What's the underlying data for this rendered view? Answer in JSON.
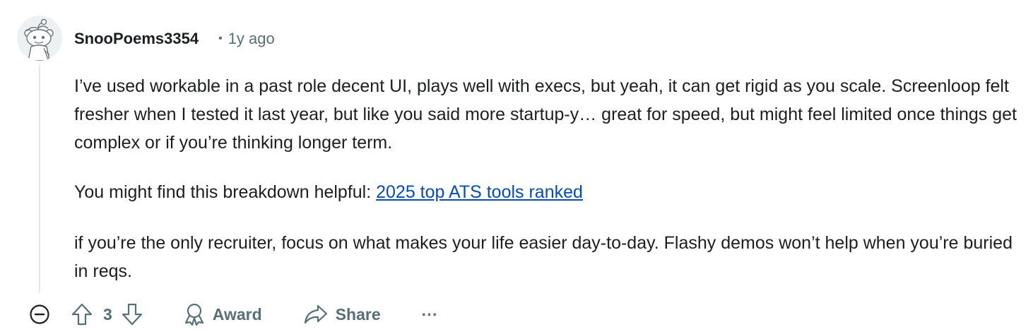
{
  "comment": {
    "username": "SnooPoems3354",
    "separator": "•",
    "timestamp": "1y ago",
    "paragraph1": "I’ve used workable in a past role decent UI, plays well with execs, but yeah, it can get rigid as you scale. Screenloop felt fresher when I tested it last year, but like you said more startup-y… great for speed, but might feel limited once things get complex or if you’re thinking longer term.",
    "paragraph2_prefix": "You might find this breakdown helpful: ",
    "link_text": "2025 top ATS tools ranked",
    "paragraph3": "if you’re the only recruiter, focus on what makes your life easier day-to-day. Flashy demos won’t help when you’re buried in reqs."
  },
  "actions": {
    "vote_count": "3",
    "award_label": "Award",
    "share_label": "Share",
    "more_label": "···"
  },
  "icons": {
    "avatar": "snoo-avatar-icon",
    "collapse": "collapse-minus-icon",
    "upvote": "upvote-arrow-icon",
    "downvote": "downvote-arrow-icon",
    "award": "award-icon",
    "share": "share-arrow-icon"
  },
  "colors": {
    "text": "#1c1e21",
    "meta": "#576f76",
    "link": "#0a4bb0",
    "thread_line": "#e3e6e8"
  }
}
